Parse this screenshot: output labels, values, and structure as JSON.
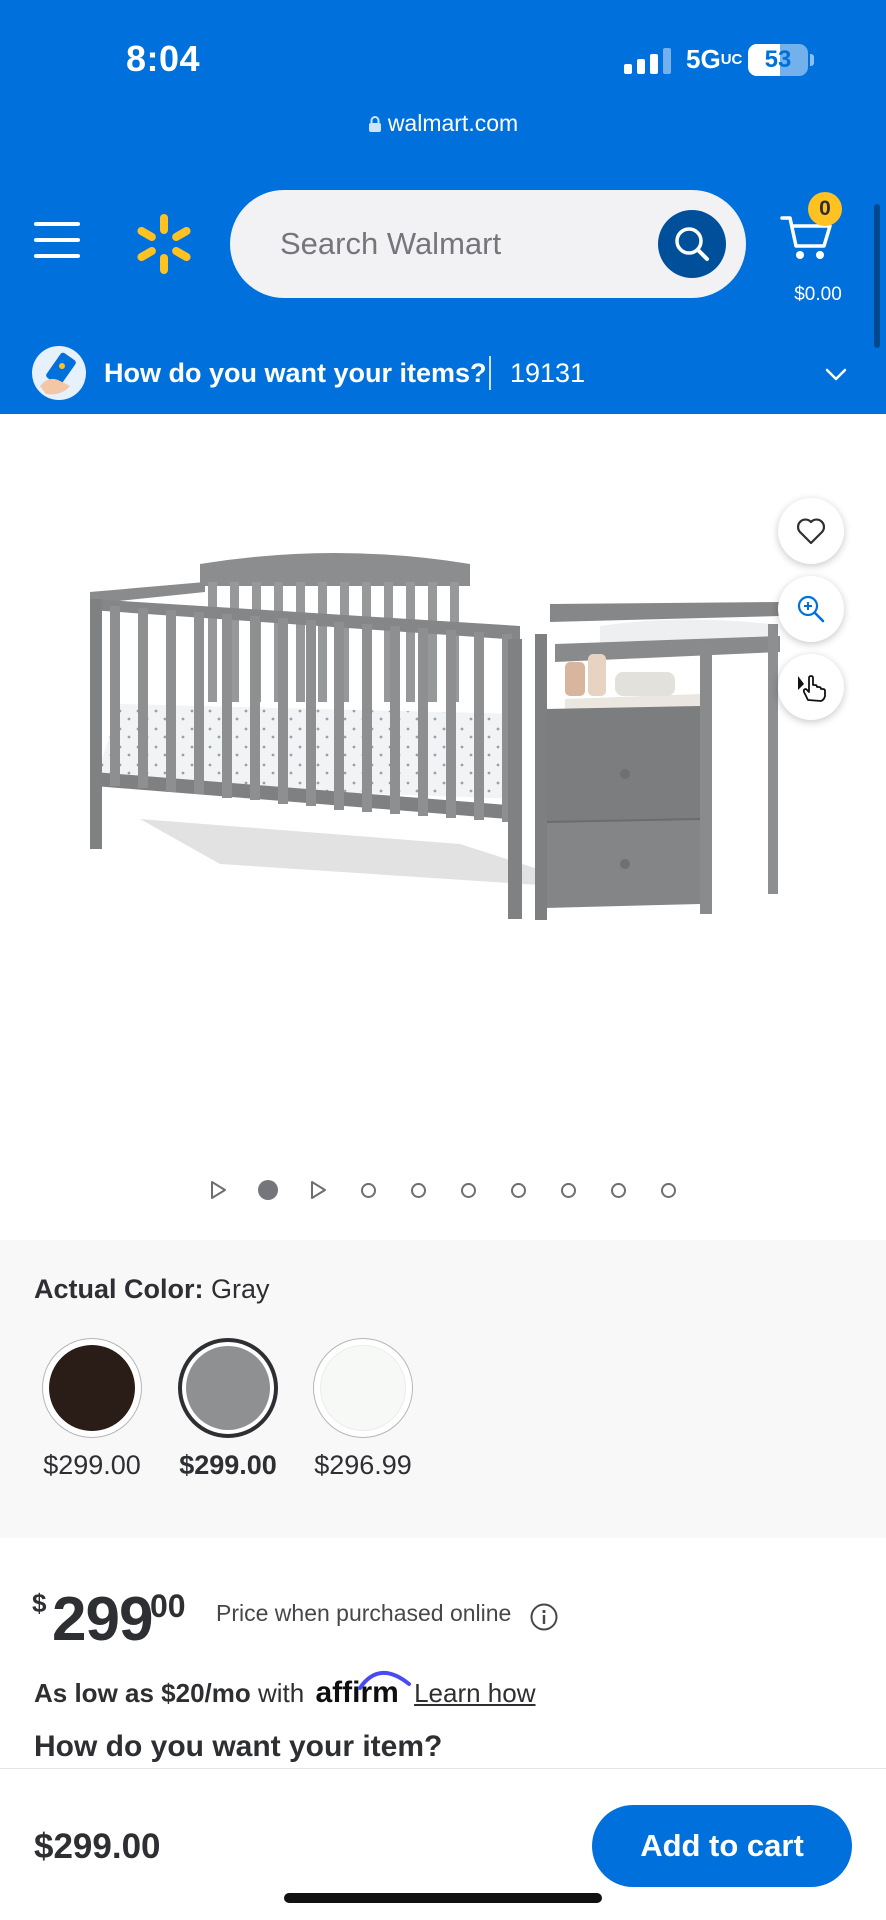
{
  "status_bar": {
    "time": "8:04",
    "network": "5G",
    "network_suffix": "UC",
    "battery": "53",
    "battery_level": 0.53,
    "url": "walmart.com"
  },
  "header": {
    "search_placeholder": "Search Walmart",
    "cart_count": "0",
    "cart_total": "$0.00",
    "brand_color": "#0071dc",
    "spark_color": "#ffc220"
  },
  "delivery": {
    "prompt": "How do you want your items?",
    "zip": "19131"
  },
  "gallery": {
    "current_index": 2,
    "indicators": [
      "video",
      "image",
      "video",
      "image",
      "image",
      "image",
      "image",
      "image",
      "image",
      "image"
    ]
  },
  "color_selector": {
    "label": "Actual Color:",
    "value": "Gray",
    "swatches": [
      {
        "price": "$299.00",
        "color": "#2a1c16",
        "selected": false
      },
      {
        "price": "$299.00",
        "color": "#8f9092",
        "selected": true
      },
      {
        "price": "$296.99",
        "color": "#f7f9f6",
        "selected": false
      }
    ]
  },
  "pricing": {
    "currency_symbol": "$",
    "dollars": "299",
    "cents": "00",
    "price_note": "Price when purchased online",
    "affirm_prefix": "As low as $20/mo",
    "affirm_with": "with",
    "affirm_brand": "affirm",
    "affirm_link": "Learn how",
    "how_item": "How do you want your item?"
  },
  "bottom_bar": {
    "price": "$299.00",
    "add_to_cart": "Add to cart"
  }
}
